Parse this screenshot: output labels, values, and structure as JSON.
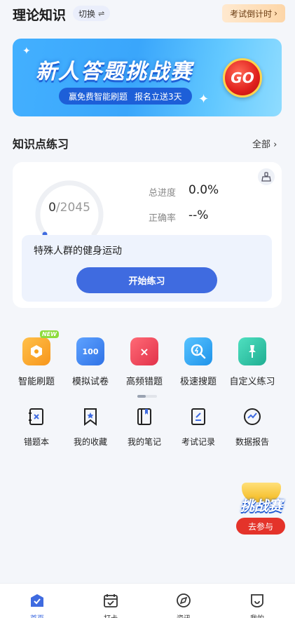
{
  "header": {
    "title": "理论知识",
    "switch_label": "切换",
    "countdown_label": "考试倒计时"
  },
  "banner": {
    "title": "新人答题挑战赛",
    "subtitle_left": "赢免费智能刷题",
    "subtitle_right": "报名立送3天",
    "go_label": "GO"
  },
  "section": {
    "title": "知识点练习",
    "all_label": "全部"
  },
  "practice_card": {
    "progress_done": "0",
    "progress_total": "/2045",
    "progress_fraction": 0.0,
    "total_progress_label": "总进度",
    "total_progress_value": "0.0%",
    "accuracy_label": "正确率",
    "accuracy_value": "--%",
    "topic": "特殊人群的健身运动",
    "start_label": "开始练习"
  },
  "features": [
    {
      "label": "智能刷题",
      "icon": "smart-practice-icon",
      "color": "#f7a21b",
      "badge": "NEW"
    },
    {
      "label": "模拟试卷",
      "icon": "mock-exam-icon",
      "color": "#3b86f0",
      "glyph": "100"
    },
    {
      "label": "高频错题",
      "icon": "frequent-mistakes-icon",
      "color": "#f0475a",
      "glyph": "×"
    },
    {
      "label": "极速搜题",
      "icon": "quick-search-icon",
      "color": "#2fa8f2"
    },
    {
      "label": "自定义练习",
      "icon": "custom-practice-icon",
      "color": "#2cc4a6"
    }
  ],
  "tools": [
    {
      "label": "错题本",
      "icon": "mistake-book-icon"
    },
    {
      "label": "我的收藏",
      "icon": "favorites-icon"
    },
    {
      "label": "我的笔记",
      "icon": "notes-icon"
    },
    {
      "label": "考试记录",
      "icon": "exam-record-icon"
    },
    {
      "label": "数据报告",
      "icon": "data-report-icon"
    }
  ],
  "floating_challenge": {
    "title": "挑战赛",
    "button_label": "去参与"
  },
  "bottom_nav": [
    {
      "label": "首页",
      "icon": "home-icon",
      "active": true
    },
    {
      "label": "打卡",
      "icon": "checkin-icon",
      "active": false
    },
    {
      "label": "资讯",
      "icon": "compass-icon",
      "active": false
    },
    {
      "label": "我的",
      "icon": "profile-icon",
      "active": false
    }
  ],
  "colors": {
    "accent": "#3f6be0",
    "background": "#f4f6fa"
  }
}
